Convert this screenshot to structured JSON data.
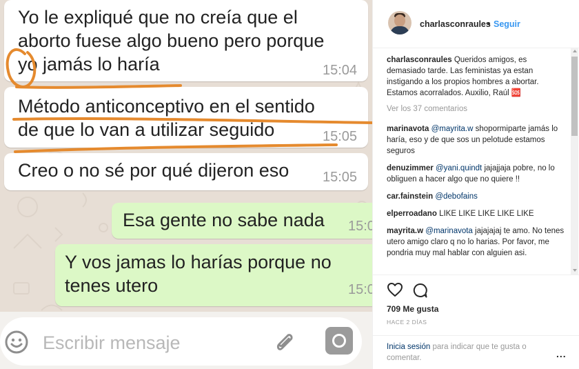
{
  "chat": {
    "messages": [
      {
        "lines": [
          "Yo le expliqué que no creía que el",
          "aborto fuese algo bueno pero porque",
          "yo jamás lo haría"
        ],
        "time": "15:04",
        "direction": "in"
      },
      {
        "lines": [
          "Método anticonceptivo en el sentido",
          "de que lo van a utilizar seguido"
        ],
        "time": "15:05",
        "direction": "in"
      },
      {
        "lines": [
          "Creo o no sé por qué dijeron eso"
        ],
        "time": "15:05",
        "direction": "in"
      },
      {
        "lines": [
          "Esa gente no sabe nada"
        ],
        "time": "15:0",
        "direction": "out"
      },
      {
        "lines": [
          "Y vos jamas lo harías porque no",
          "tenes utero"
        ],
        "time": "15:0",
        "direction": "out"
      }
    ],
    "input_placeholder": "Escribir mensaje",
    "icons": [
      "emoji-icon",
      "paperclip-icon",
      "camera-icon"
    ],
    "annotation_color": "#e58a2e"
  },
  "post": {
    "username": "charlasconraules",
    "separator": "•",
    "follow_label": "Seguir",
    "caption_user": "charlasconraules",
    "caption_text": "Queridos amigos, es demasiado tarde. Las feministas ya estan instigando a los propios hombres a abortar. Estamos acorralados. Auxilio, Raúl 🆘",
    "view_all": "Ver los 37 comentarios",
    "comments": [
      {
        "user": "marinavota",
        "mention": "@mayrita.w",
        "text": "shopormiparte jamás lo haría, eso y de que sos un pelotude estamos seguros"
      },
      {
        "user": "denuzimmer",
        "mention": "@yani.quindt",
        "text": "jajajjaja pobre, no lo obliguen a hacer algo que no quiere !!"
      },
      {
        "user": "car.fainstein",
        "mention": "@debofains",
        "text": ""
      },
      {
        "user": "elperroadano",
        "mention": "",
        "text": "LIKE LIKE LIKE LIKE LIKE"
      },
      {
        "user": "mayrita.w",
        "mention": "@marinavota",
        "text": "jajajajaj te amo. No tenes utero amigo claro q no lo harias. Por favor, me pondria muy mal hablar con alguien asi."
      }
    ],
    "likes": "709 Me gusta",
    "time_ago": "HACE 2 DÍAS",
    "login_link": "Inicia sesión",
    "login_text": "para indicar que te gusta o comentar.",
    "more_label": "...",
    "colors": {
      "link": "#3897f0",
      "mention": "#003569",
      "muted": "#999999"
    }
  }
}
